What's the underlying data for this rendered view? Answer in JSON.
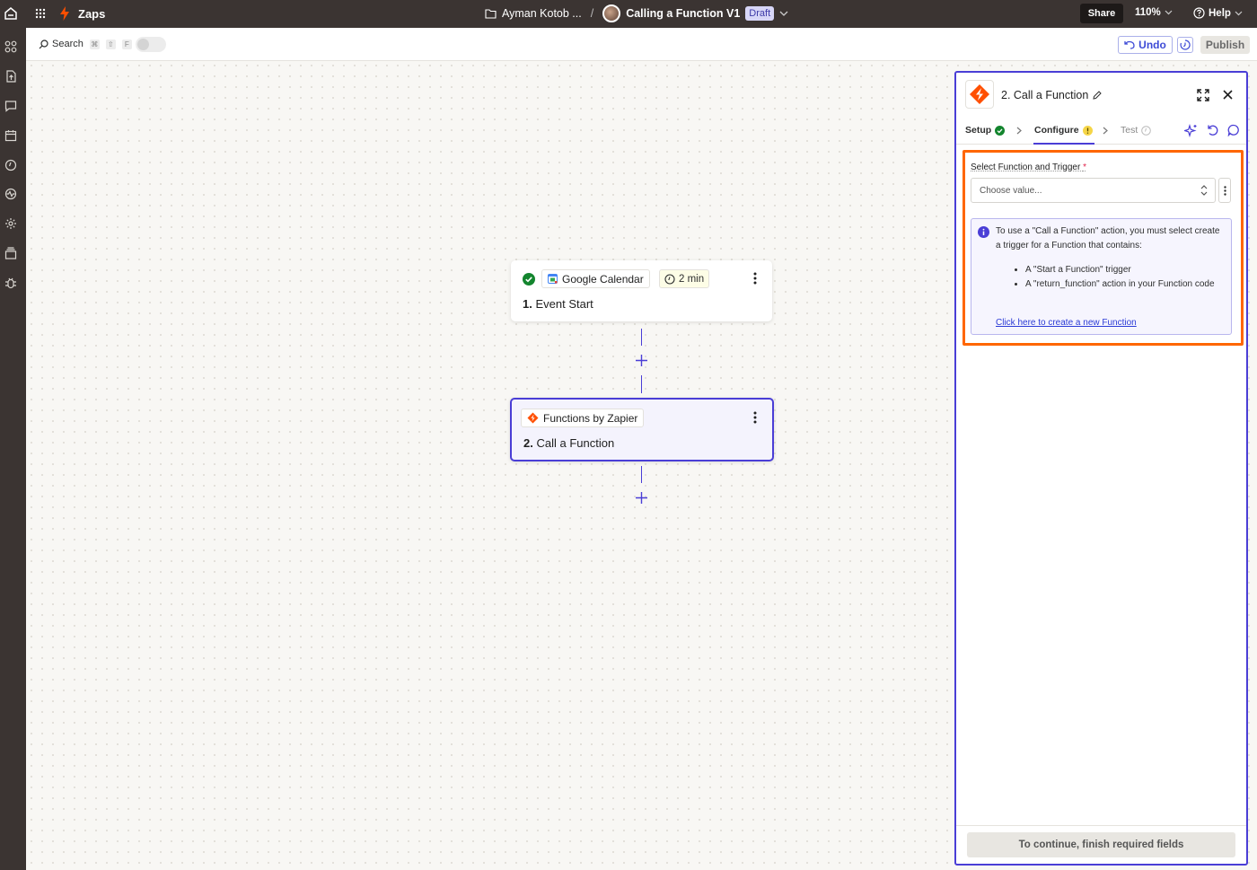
{
  "topbar": {
    "app_name": "Zaps",
    "folder": "Ayman Kotob ...",
    "separator": "/",
    "zap_name": "Calling a Function V1",
    "status": "Draft",
    "share_label": "Share",
    "zoom": "110%",
    "help_label": "Help"
  },
  "toolbar": {
    "search_label": "Search",
    "shortcut_keys": [
      "⌘",
      "⇧",
      "F"
    ],
    "undo_label": "Undo",
    "publish_label": "Publish"
  },
  "canvas": {
    "steps": [
      {
        "app": "Google Calendar",
        "duration": "2 min",
        "number": "1.",
        "title": "Event Start"
      },
      {
        "app": "Functions by Zapier",
        "number": "2.",
        "title": "Call a Function"
      }
    ]
  },
  "panel": {
    "title": "2. Call a Function",
    "tabs": [
      {
        "label": "Setup"
      },
      {
        "label": "Configure"
      },
      {
        "label": "Test"
      }
    ],
    "field": {
      "label": "Select Function and Trigger",
      "required_mark": "*",
      "placeholder": "Choose value..."
    },
    "info": {
      "text": "To use a \"Call a Function\" action, you must select create a trigger for a Function that contains:",
      "bullets": [
        "A \"Start a Function\" trigger",
        "A \"return_function\" action in your Function code"
      ],
      "link": "Click here to create a new Function"
    },
    "continue_label": "To continue, finish required fields"
  },
  "colors": {
    "accent": "#4a3ed6",
    "highlight": "#ff6600",
    "zapier_orange": "#ff4f00",
    "success": "#13852e"
  }
}
